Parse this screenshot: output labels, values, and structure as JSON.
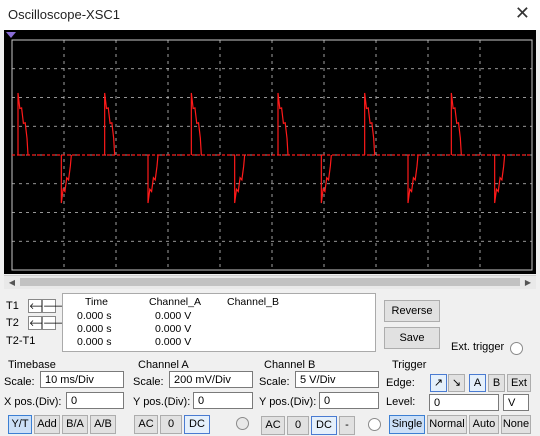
{
  "window": {
    "title": "Oscilloscope-XSC1",
    "close_glyph": "✕"
  },
  "cursors": {
    "t1_label": "T1",
    "t2_label": "T2",
    "diff_label": "T2-T1",
    "left_glyph": "🡐",
    "right_glyph": "🡒"
  },
  "readout": {
    "headers": {
      "time": "Time",
      "channel_a": "Channel_A",
      "channel_b": "Channel_B"
    },
    "rows": [
      {
        "time": "0.000 s",
        "channel_a": "0.000 V"
      },
      {
        "time": "0.000 s",
        "channel_a": "0.000 V"
      },
      {
        "time": "0.000 s",
        "channel_a": "0.000 V"
      }
    ]
  },
  "actions": {
    "reverse": "Reverse",
    "save": "Save",
    "ext_trigger": "Ext. trigger"
  },
  "timebase": {
    "title": "Timebase",
    "scale_label": "Scale:",
    "scale_value": "10 ms/Div",
    "xpos_label": "X pos.(Div):",
    "xpos_value": "0",
    "modes": [
      "Y/T",
      "Add",
      "B/A",
      "A/B"
    ],
    "selected_mode": "Y/T"
  },
  "channel_a": {
    "title": "Channel A",
    "scale_label": "Scale:",
    "scale_value": "200 mV/Div",
    "ypos_label": "Y pos.(Div):",
    "ypos_value": "0",
    "coupling": [
      "AC",
      "0",
      "DC"
    ],
    "selected": "DC"
  },
  "channel_b": {
    "title": "Channel B",
    "scale_label": "Scale:",
    "scale_value": "5  V/Div",
    "ypos_label": "Y pos.(Div):",
    "ypos_value": "0",
    "coupling": [
      "AC",
      "0",
      "DC",
      "-"
    ],
    "selected": "DC"
  },
  "trigger": {
    "title": "Trigger",
    "edge_label": "Edge:",
    "edge_rise": "↗",
    "edge_fall": "↘",
    "sources": [
      "A",
      "B",
      "Ext"
    ],
    "selected_source": "A",
    "level_label": "Level:",
    "level_value": "0",
    "level_unit": "V",
    "modes": [
      "Single",
      "Normal",
      "Auto",
      "None"
    ],
    "selected_mode": "Single"
  },
  "colors": {
    "screen_bg": "#000000",
    "grid": "#c8c8c8",
    "trace_a": "#ff1a1a",
    "accent": "#3c7fd3"
  }
}
